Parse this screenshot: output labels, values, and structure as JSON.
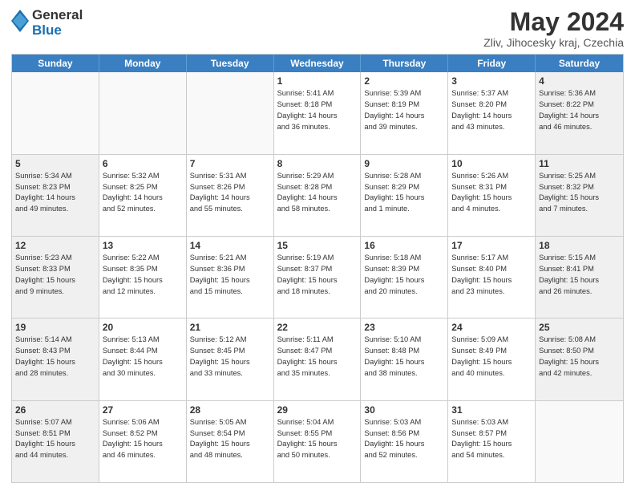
{
  "logo": {
    "line1": "General",
    "line2": "Blue"
  },
  "title": "May 2024",
  "location": "Zliv, Jihocesky kraj, Czechia",
  "days": [
    "Sunday",
    "Monday",
    "Tuesday",
    "Wednesday",
    "Thursday",
    "Friday",
    "Saturday"
  ],
  "rows": [
    [
      {
        "day": "",
        "text": ""
      },
      {
        "day": "",
        "text": ""
      },
      {
        "day": "",
        "text": ""
      },
      {
        "day": "1",
        "text": "Sunrise: 5:41 AM\nSunset: 8:18 PM\nDaylight: 14 hours\nand 36 minutes."
      },
      {
        "day": "2",
        "text": "Sunrise: 5:39 AM\nSunset: 8:19 PM\nDaylight: 14 hours\nand 39 minutes."
      },
      {
        "day": "3",
        "text": "Sunrise: 5:37 AM\nSunset: 8:20 PM\nDaylight: 14 hours\nand 43 minutes."
      },
      {
        "day": "4",
        "text": "Sunrise: 5:36 AM\nSunset: 8:22 PM\nDaylight: 14 hours\nand 46 minutes."
      }
    ],
    [
      {
        "day": "5",
        "text": "Sunrise: 5:34 AM\nSunset: 8:23 PM\nDaylight: 14 hours\nand 49 minutes."
      },
      {
        "day": "6",
        "text": "Sunrise: 5:32 AM\nSunset: 8:25 PM\nDaylight: 14 hours\nand 52 minutes."
      },
      {
        "day": "7",
        "text": "Sunrise: 5:31 AM\nSunset: 8:26 PM\nDaylight: 14 hours\nand 55 minutes."
      },
      {
        "day": "8",
        "text": "Sunrise: 5:29 AM\nSunset: 8:28 PM\nDaylight: 14 hours\nand 58 minutes."
      },
      {
        "day": "9",
        "text": "Sunrise: 5:28 AM\nSunset: 8:29 PM\nDaylight: 15 hours\nand 1 minute."
      },
      {
        "day": "10",
        "text": "Sunrise: 5:26 AM\nSunset: 8:31 PM\nDaylight: 15 hours\nand 4 minutes."
      },
      {
        "day": "11",
        "text": "Sunrise: 5:25 AM\nSunset: 8:32 PM\nDaylight: 15 hours\nand 7 minutes."
      }
    ],
    [
      {
        "day": "12",
        "text": "Sunrise: 5:23 AM\nSunset: 8:33 PM\nDaylight: 15 hours\nand 9 minutes."
      },
      {
        "day": "13",
        "text": "Sunrise: 5:22 AM\nSunset: 8:35 PM\nDaylight: 15 hours\nand 12 minutes."
      },
      {
        "day": "14",
        "text": "Sunrise: 5:21 AM\nSunset: 8:36 PM\nDaylight: 15 hours\nand 15 minutes."
      },
      {
        "day": "15",
        "text": "Sunrise: 5:19 AM\nSunset: 8:37 PM\nDaylight: 15 hours\nand 18 minutes."
      },
      {
        "day": "16",
        "text": "Sunrise: 5:18 AM\nSunset: 8:39 PM\nDaylight: 15 hours\nand 20 minutes."
      },
      {
        "day": "17",
        "text": "Sunrise: 5:17 AM\nSunset: 8:40 PM\nDaylight: 15 hours\nand 23 minutes."
      },
      {
        "day": "18",
        "text": "Sunrise: 5:15 AM\nSunset: 8:41 PM\nDaylight: 15 hours\nand 26 minutes."
      }
    ],
    [
      {
        "day": "19",
        "text": "Sunrise: 5:14 AM\nSunset: 8:43 PM\nDaylight: 15 hours\nand 28 minutes."
      },
      {
        "day": "20",
        "text": "Sunrise: 5:13 AM\nSunset: 8:44 PM\nDaylight: 15 hours\nand 30 minutes."
      },
      {
        "day": "21",
        "text": "Sunrise: 5:12 AM\nSunset: 8:45 PM\nDaylight: 15 hours\nand 33 minutes."
      },
      {
        "day": "22",
        "text": "Sunrise: 5:11 AM\nSunset: 8:47 PM\nDaylight: 15 hours\nand 35 minutes."
      },
      {
        "day": "23",
        "text": "Sunrise: 5:10 AM\nSunset: 8:48 PM\nDaylight: 15 hours\nand 38 minutes."
      },
      {
        "day": "24",
        "text": "Sunrise: 5:09 AM\nSunset: 8:49 PM\nDaylight: 15 hours\nand 40 minutes."
      },
      {
        "day": "25",
        "text": "Sunrise: 5:08 AM\nSunset: 8:50 PM\nDaylight: 15 hours\nand 42 minutes."
      }
    ],
    [
      {
        "day": "26",
        "text": "Sunrise: 5:07 AM\nSunset: 8:51 PM\nDaylight: 15 hours\nand 44 minutes."
      },
      {
        "day": "27",
        "text": "Sunrise: 5:06 AM\nSunset: 8:52 PM\nDaylight: 15 hours\nand 46 minutes."
      },
      {
        "day": "28",
        "text": "Sunrise: 5:05 AM\nSunset: 8:54 PM\nDaylight: 15 hours\nand 48 minutes."
      },
      {
        "day": "29",
        "text": "Sunrise: 5:04 AM\nSunset: 8:55 PM\nDaylight: 15 hours\nand 50 minutes."
      },
      {
        "day": "30",
        "text": "Sunrise: 5:03 AM\nSunset: 8:56 PM\nDaylight: 15 hours\nand 52 minutes."
      },
      {
        "day": "31",
        "text": "Sunrise: 5:03 AM\nSunset: 8:57 PM\nDaylight: 15 hours\nand 54 minutes."
      },
      {
        "day": "",
        "text": ""
      }
    ]
  ]
}
